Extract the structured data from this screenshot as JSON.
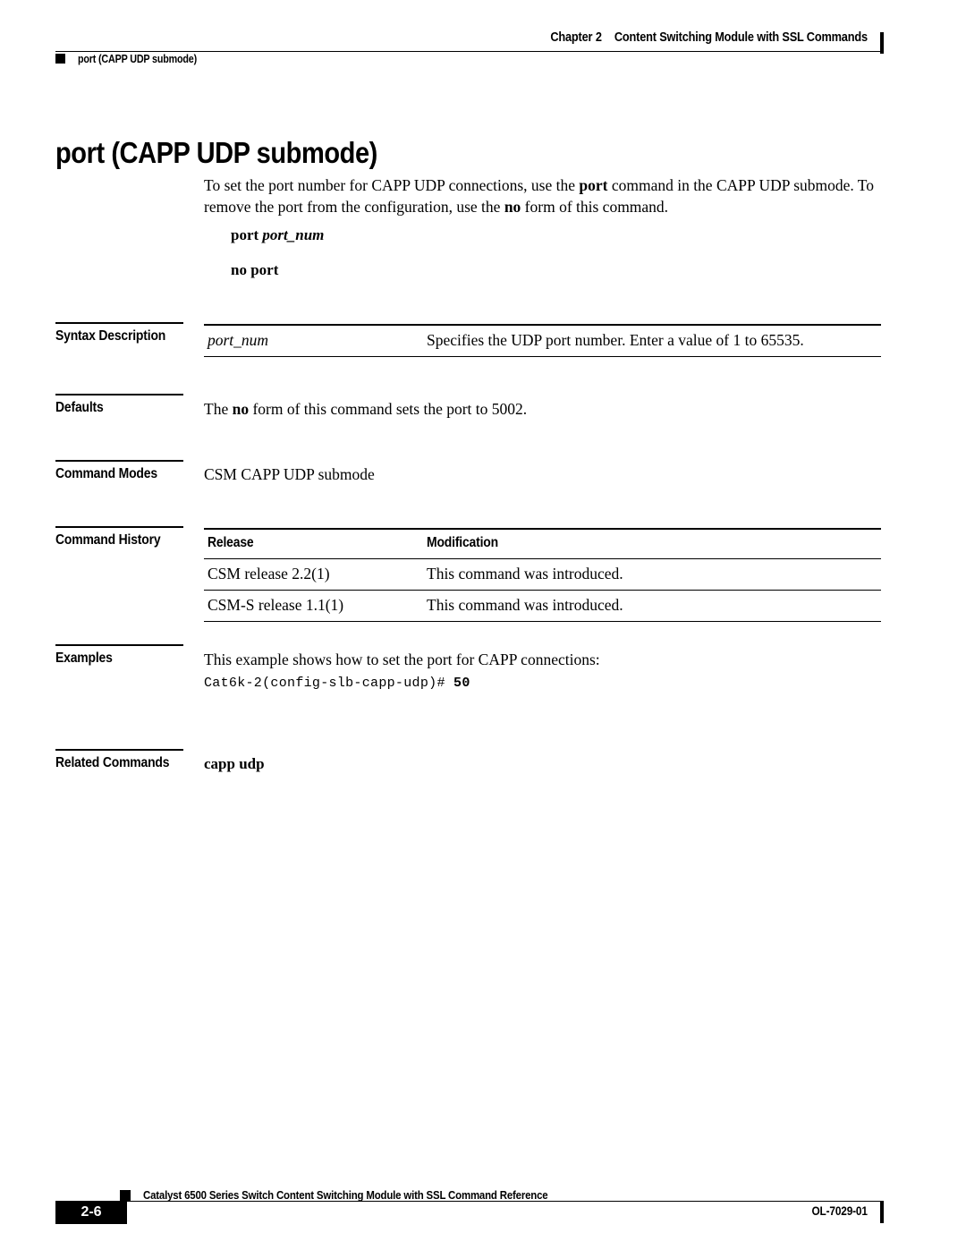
{
  "header": {
    "chapter_label": "Chapter",
    "chapter_number": "2",
    "chapter_title": "Content Switching Module with SSL Commands",
    "running_head": "port (CAPP UDP submode)"
  },
  "title": "port (CAPP UDP submode)",
  "intro": {
    "part1": "To set the port number for CAPP UDP connections, use the ",
    "bold1": "port",
    "part2": " command in the CAPP UDP submode. To remove the port from the configuration, use the ",
    "bold2": "no",
    "part3": " form of this command."
  },
  "syntax": {
    "usage_command": "port",
    "usage_variable": "port_num",
    "no_form": "no port"
  },
  "sections": {
    "syntax_description": {
      "label": "Syntax Description",
      "rows": [
        {
          "parameter": "port_num",
          "description": "Specifies the UDP port number. Enter a value of 1 to 65535."
        }
      ]
    },
    "defaults": {
      "label": "Defaults",
      "text_part1": "The ",
      "text_bold": "no",
      "text_part2": " form of this command sets the port to 5002."
    },
    "command_modes": {
      "label": "Command Modes",
      "text": "CSM CAPP UDP submode"
    },
    "command_history": {
      "label": "Command History",
      "columns": [
        "Release",
        "Modification"
      ],
      "rows": [
        [
          "CSM release 2.2(1)",
          "This command was introduced."
        ],
        [
          "CSM-S release 1.1(1)",
          "This command was introduced."
        ]
      ]
    },
    "examples": {
      "label": "Examples",
      "intro": "This example shows how to set the port for CAPP connections:",
      "code_prompt": "Cat6k-2(config-slb-capp-udp)# ",
      "code_value": "50"
    },
    "related_commands": {
      "label": "Related Commands",
      "items": [
        "capp udp"
      ]
    }
  },
  "footer": {
    "document_title": "Catalyst 6500 Series Switch Content Switching Module with SSL Command Reference",
    "page_number": "2-6",
    "document_id": "OL-7029-01"
  }
}
